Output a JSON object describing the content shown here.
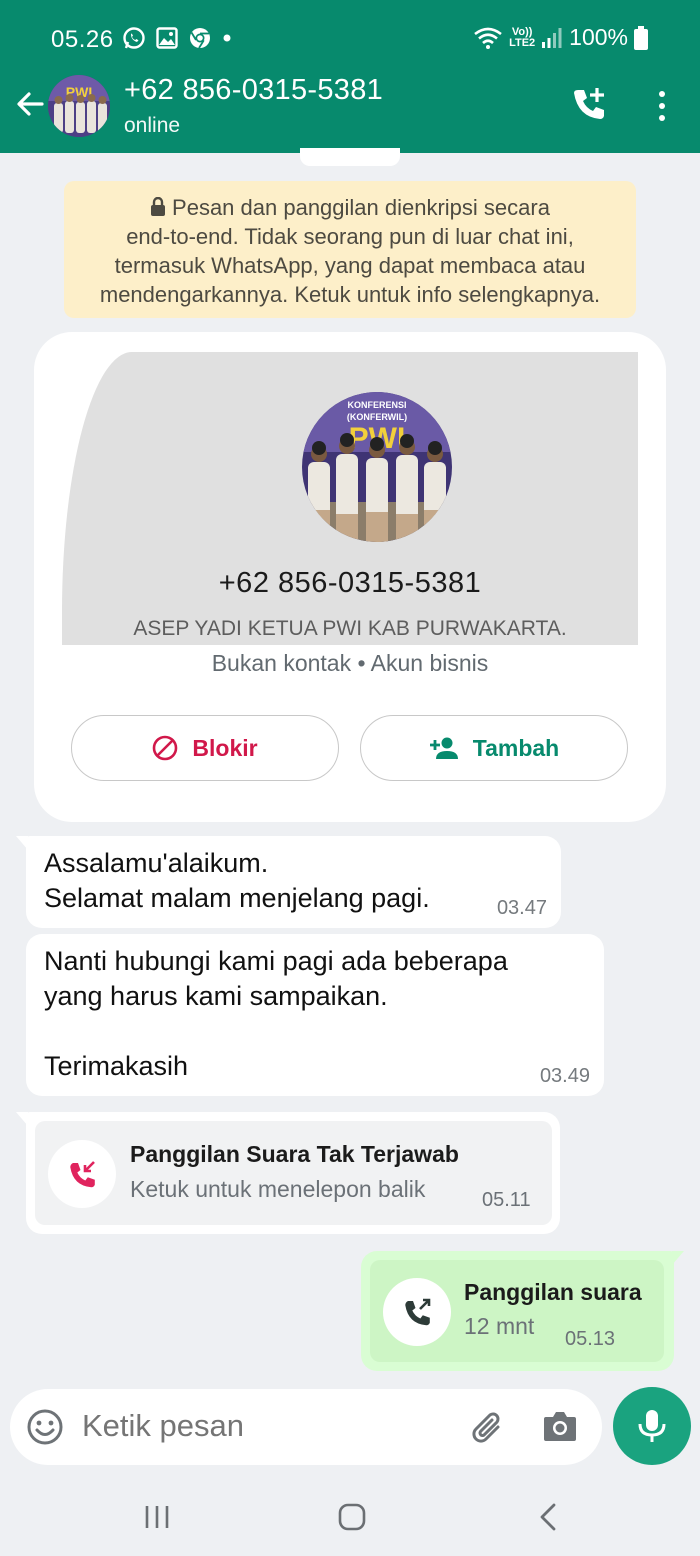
{
  "status_bar": {
    "time": "05.26",
    "net_top": "Vo))",
    "net_bottom": "LTE2",
    "battery": "100%"
  },
  "header": {
    "contact_number": "+62 856-0315-5381",
    "contact_status": "online"
  },
  "encryption_notice": {
    "lines": [
      "Pesan dan panggilan dienkripsi secara",
      "end-to-end. Tidak seorang pun di luar chat ini,",
      "termasuk WhatsApp, yang dapat membaca atau",
      "mendengarkannya. Ketuk untuk info selengkapnya."
    ]
  },
  "business_card": {
    "number": "+62 856-0315-5381",
    "business_name": "ASEP YADI KETUA PWI KAB PURWAKARTA.",
    "meta": "Bukan kontak • Akun bisnis",
    "block_label": "Blokir",
    "add_label": "Tambah"
  },
  "messages": [
    {
      "line1": "Assalamu'alaikum.",
      "line2": "Selamat malam menjelang pagi.",
      "time": "03.47"
    },
    {
      "line1": "Nanti hubungi kami pagi ada beberapa",
      "line2": "yang harus kami sampaikan.",
      "line3": "Terimakasih",
      "time": "03.49"
    }
  ],
  "missed_call": {
    "title": "Panggilan Suara Tak Terjawab",
    "subtitle": "Ketuk untuk menelepon balik",
    "time": "05.11"
  },
  "outgoing_call": {
    "title": "Panggilan suara",
    "duration": "12 mnt",
    "time": "05.13"
  },
  "composer": {
    "placeholder": "Ketik pesan"
  },
  "colors": {
    "header": "#078a6d",
    "accent": "#1aa37f",
    "danger": "#d1184a",
    "outgoing_bubble": "#d9fdd3",
    "notice": "#fdefc9"
  }
}
